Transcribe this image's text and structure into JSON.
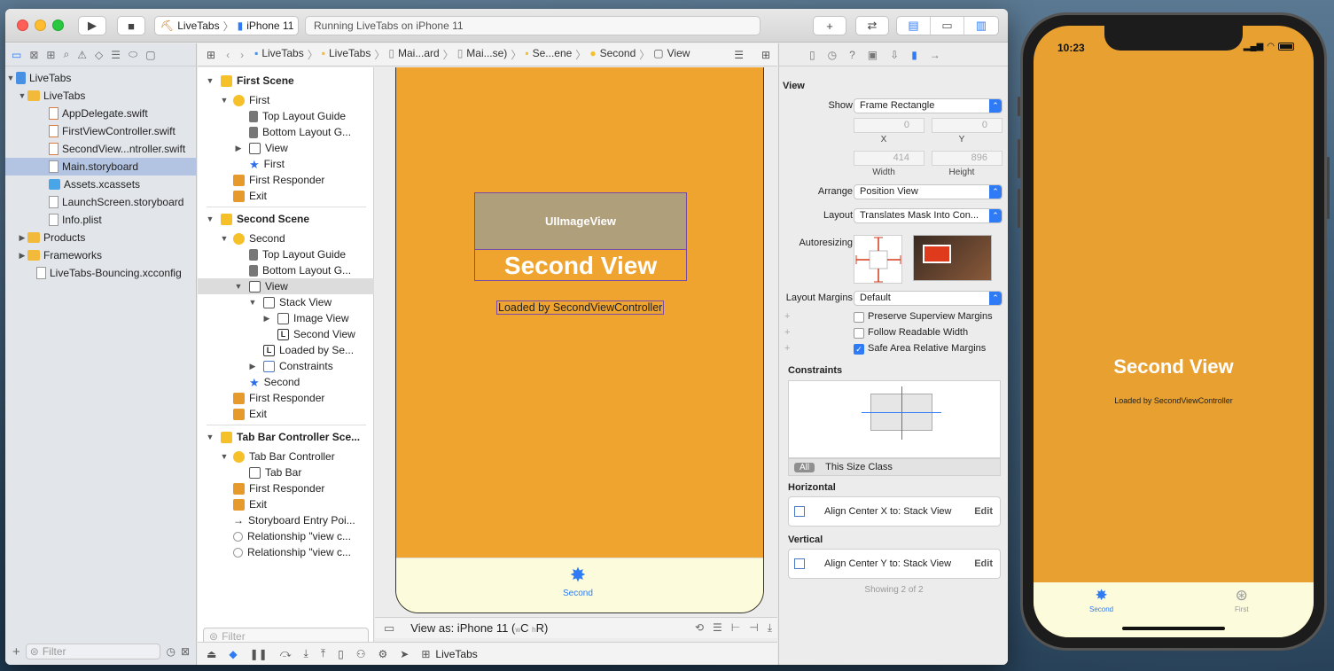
{
  "toolbar": {
    "scheme_target": "LiveTabs",
    "scheme_device": "iPhone 11",
    "status_text": "Running LiveTabs on iPhone 11",
    "add_glyph": "+",
    "back_forward_glyph": "⇄"
  },
  "navigator": {
    "items": [
      {
        "label": "LiveTabs",
        "type": "project"
      },
      {
        "label": "LiveTabs",
        "type": "folder"
      },
      {
        "label": "AppDelegate.swift",
        "type": "swift"
      },
      {
        "label": "FirstViewController.swift",
        "type": "swift"
      },
      {
        "label": "SecondView...ntroller.swift",
        "type": "swift"
      },
      {
        "label": "Main.storyboard",
        "type": "file"
      },
      {
        "label": "Assets.xcassets",
        "type": "assets"
      },
      {
        "label": "LaunchScreen.storyboard",
        "type": "file"
      },
      {
        "label": "Info.plist",
        "type": "file"
      },
      {
        "label": "Products",
        "type": "folder"
      },
      {
        "label": "Frameworks",
        "type": "folder"
      },
      {
        "label": "LiveTabs-Bouncing.xcconfig",
        "type": "file"
      }
    ],
    "filter_placeholder": "Filter"
  },
  "jumpbar": {
    "crumbs": [
      "LiveTabs",
      "LiveTabs",
      "Mai...ard",
      "Mai...se)",
      "Se...ene",
      "Second",
      "View"
    ]
  },
  "outline": {
    "rows": [
      {
        "label": "First Scene"
      },
      {
        "label": "First"
      },
      {
        "label": "Top Layout Guide"
      },
      {
        "label": "Bottom Layout G..."
      },
      {
        "label": "View"
      },
      {
        "label": "First"
      },
      {
        "label": "First Responder"
      },
      {
        "label": "Exit"
      },
      {
        "label": "Second Scene"
      },
      {
        "label": "Second"
      },
      {
        "label": "Top Layout Guide"
      },
      {
        "label": "Bottom Layout G..."
      },
      {
        "label": "View"
      },
      {
        "label": "Stack View"
      },
      {
        "label": "Image View"
      },
      {
        "label": "Second View"
      },
      {
        "label": "Loaded by Se..."
      },
      {
        "label": "Constraints"
      },
      {
        "label": "Second"
      },
      {
        "label": "First Responder"
      },
      {
        "label": "Exit"
      },
      {
        "label": "Tab Bar Controller Sce..."
      },
      {
        "label": "Tab Bar Controller"
      },
      {
        "label": "Tab Bar"
      },
      {
        "label": "First Responder"
      },
      {
        "label": "Exit"
      },
      {
        "label": "Storyboard Entry Poi..."
      },
      {
        "label": "Relationship \"view c..."
      },
      {
        "label": "Relationship \"view c..."
      }
    ],
    "label_glyph": "L",
    "filter_placeholder": "Filter"
  },
  "canvas": {
    "image_view_label": "UIImageView",
    "second_view_label": "Second View",
    "loaded_label": "Loaded by SecondViewController",
    "tab_label": "Second",
    "view_as": "View as: iPhone 11 (",
    "size_class_w": "w",
    "size_class_c": "C ",
    "size_class_h": "h",
    "size_class_r": "R)"
  },
  "debugbar": {
    "target_label": "LiveTabs"
  },
  "inspector": {
    "title": "View",
    "show_label": "Show",
    "show_value": "Frame Rectangle",
    "x_value": "0",
    "y_value": "0",
    "x_caption": "X",
    "y_caption": "Y",
    "width_value": "414",
    "height_value": "896",
    "width_caption": "Width",
    "height_caption": "Height",
    "arrange_label": "Arrange",
    "arrange_value": "Position View",
    "layout_label": "Layout",
    "layout_value": "Translates Mask Into Con...",
    "autoresizing_label": "Autoresizing",
    "layout_margins_label": "Layout Margins",
    "layout_margins_value": "Default",
    "checkbox_preserve": "Preserve Superview Margins",
    "checkbox_readable": "Follow Readable Width",
    "checkbox_safe_area": "Safe Area Relative Margins",
    "checkbox_checked": {
      "preserve": false,
      "readable": false,
      "safe_area": true
    },
    "plus_glyph": "+",
    "constraints_title": "Constraints",
    "size_class_all": "All",
    "size_class_this": "This Size Class",
    "horizontal_title": "Horizontal",
    "horizontal_constraint": "Align Center X to:  Stack View",
    "vertical_title": "Vertical",
    "vertical_constraint": "Align Center Y to:  Stack View",
    "edit_label": "Edit",
    "showing_text": "Showing 2 of 2"
  },
  "simulator": {
    "time": "10:23",
    "title": "Second View",
    "subtitle": "Loaded by SecondViewController",
    "tabs": [
      {
        "label": "Second",
        "active": true
      },
      {
        "label": "First",
        "active": false
      }
    ]
  },
  "colors": {
    "accent": "#2f7bf5",
    "canvas_background": "#f0a430",
    "simulator_background": "#e8a131",
    "tabbar_background": "#fcfbdb"
  }
}
